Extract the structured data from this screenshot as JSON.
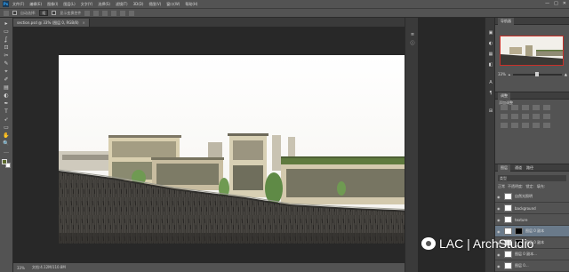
{
  "menubar": {
    "app_logo": "Ps",
    "items": [
      "文件(F)",
      "编辑(E)",
      "图像(I)",
      "图层(L)",
      "文字(Y)",
      "选择(S)",
      "滤镜(T)",
      "3D(D)",
      "视图(V)",
      "窗口(W)",
      "帮助(H)"
    ],
    "window_buttons": [
      "—",
      "□",
      "✕"
    ]
  },
  "options": {
    "auto_select_label": "自动选择:",
    "auto_select_value": "组",
    "show_transform_label": "显示变换控件"
  },
  "document": {
    "tab_label": "section.psd @ 33% (图层 0, RGB/8)",
    "close": "×"
  },
  "status": {
    "zoom": "33%",
    "doc_size": "文档:4.12M/110.8M"
  },
  "toolbar": {
    "tools": [
      "▸",
      "▭",
      "ʆ",
      "⊡",
      "✂",
      "✎",
      "⌖",
      "✐",
      "▤",
      "◐",
      "✒",
      "T",
      "➶",
      "▭",
      "✋",
      "🔍",
      "…"
    ]
  },
  "panels": {
    "navigator_tab": "导航器",
    "navigator_zoom": "33%",
    "adjustments_tab": "调整",
    "adjustments_title": "添加调整",
    "layers_tabs": [
      "图层",
      "通道",
      "路径"
    ],
    "layer_filter": "类型",
    "blend_mode": "正常",
    "opacity_label": "不透明度:",
    "lock_label": "锁定:",
    "fill_label": "填充:",
    "layers": [
      {
        "name": "自然光照明",
        "selected": false
      },
      {
        "name": "background",
        "selected": false
      },
      {
        "name": "texture",
        "selected": false
      },
      {
        "name": "图层 0 副本",
        "selected": true
      },
      {
        "name": "图层 0 副本",
        "selected": false
      },
      {
        "name": "图层 0 副本...",
        "selected": false
      },
      {
        "name": "图层 0...",
        "selected": false
      },
      {
        "name": "building",
        "selected": false
      }
    ]
  },
  "watermark": {
    "text": "LAC | ArchStudio"
  },
  "colors": {
    "ui_dark": "#282828",
    "ui_panel": "#535353",
    "selection": "#6a7a8a",
    "canvas_bg": "#ffffff"
  }
}
